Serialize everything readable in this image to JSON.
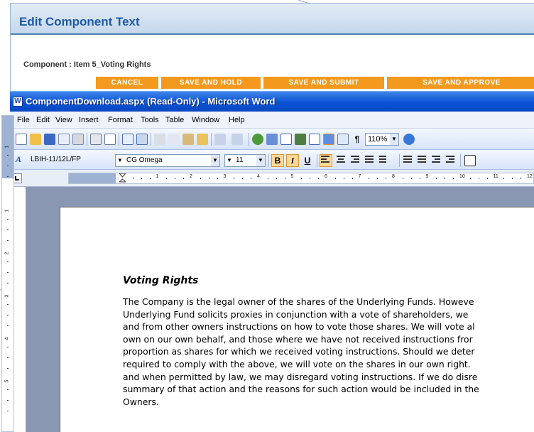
{
  "web": {
    "title": "Edit Component Text",
    "component_label": "Component : Item 5_Voting Rights",
    "buttons": {
      "cancel": "CANCEL",
      "save_hold": "SAVE AND HOLD",
      "save_submit": "SAVE AND SUBMIT",
      "save_approve": "SAVE AND APPROVE"
    }
  },
  "word": {
    "window_title": "ComponentDownload.aspx (Read-Only) - Microsoft Word",
    "app_icon": "W",
    "menu": [
      "File",
      "Edit",
      "View",
      "Insert",
      "Format",
      "Tools",
      "Table",
      "Window",
      "Help"
    ],
    "zoom": "110%",
    "style": "LBIH-11/12L/FP",
    "font": "CG Omega",
    "font_size": "11",
    "format_buttons": {
      "bold": "B",
      "italic": "I",
      "underline": "U"
    },
    "pilcrow": "¶",
    "ruler_numbers": [
      "1",
      "2",
      "3",
      "4",
      "5",
      "6",
      "7",
      "8",
      "9",
      "10",
      "11",
      "12"
    ],
    "vruler_numbers": [
      "1",
      "1",
      "2",
      "3",
      "4",
      "5"
    ]
  },
  "document": {
    "heading": "Voting Rights",
    "lines": [
      "The Company is the legal owner of the shares of the Underlying Funds. Howeve",
      "Underlying Fund solicits proxies in conjunction with a vote of shareholders, we",
      "and from other owners instructions on how to vote those shares. We will vote al",
      "own on our own behalf, and those where we have not received instructions fror",
      "proportion as shares for which we received voting instructions. Should we deter",
      "required to comply with the above, we will vote on the shares in our own right.",
      "and when permitted by law, we may disregard voting instructions. If we do disre",
      "summary of that action and the reasons for such action would be included in the",
      "Owners."
    ]
  },
  "colors": {
    "title_blue": "#1f5aa3",
    "button_orange": "#f39a1e",
    "xp_titlebar": "#0a52d6",
    "workspace": "#8a97b3"
  }
}
